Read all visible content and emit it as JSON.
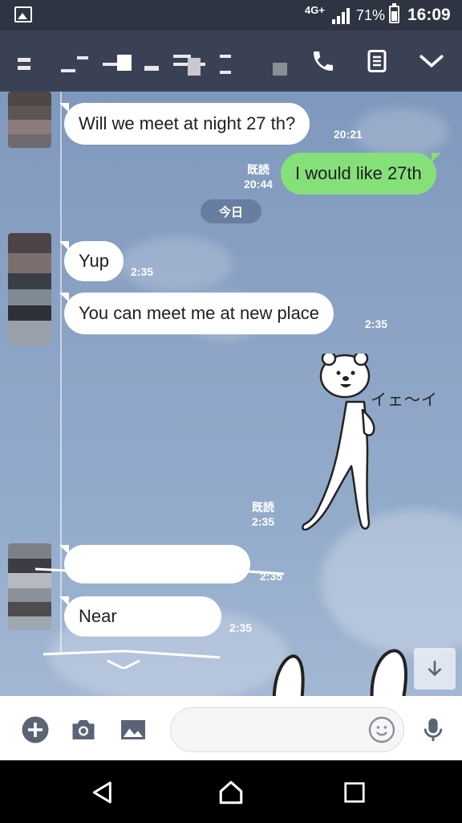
{
  "status_bar": {
    "network": "4G+",
    "battery_percent": "71%",
    "battery_level": 0.71,
    "time": "16:09",
    "icons": [
      "gallery-icon",
      "signal-icon",
      "battery-icon"
    ]
  },
  "header": {
    "title": "",
    "icons": [
      "call-icon",
      "notes-icon",
      "chevron-down-icon"
    ]
  },
  "chat": {
    "date_divider": "今日",
    "messages": [
      {
        "from": "them",
        "text": "Will we meet at night 27 th?",
        "time": "20:21"
      },
      {
        "from": "me",
        "text": "I would like 27th",
        "read": "既読",
        "time": "20:44"
      },
      {
        "from": "them",
        "text": "Yup",
        "time": "2:35"
      },
      {
        "from": "them",
        "text": "You can meet me at new place",
        "time": "2:35"
      },
      {
        "from": "me",
        "type": "sticker",
        "sticker_text": "イェ〜イ",
        "read": "既読",
        "time": "2:35"
      },
      {
        "from": "them",
        "text": "",
        "time": "2:35"
      },
      {
        "from": "them",
        "text": "Near",
        "time": "2:35"
      }
    ]
  },
  "input_bar": {
    "placeholder": "",
    "icons": [
      "add-icon",
      "camera-icon",
      "image-icon",
      "emoji-icon",
      "mic-icon"
    ]
  },
  "nav_bar": {
    "icons": [
      "back-icon",
      "home-icon",
      "recents-icon"
    ]
  },
  "colors": {
    "status_bar": "#2e3442",
    "header": "#3b4154",
    "my_bubble": "#86e07a",
    "their_bubble": "#ffffff",
    "accent_icons": "#5b6474"
  }
}
